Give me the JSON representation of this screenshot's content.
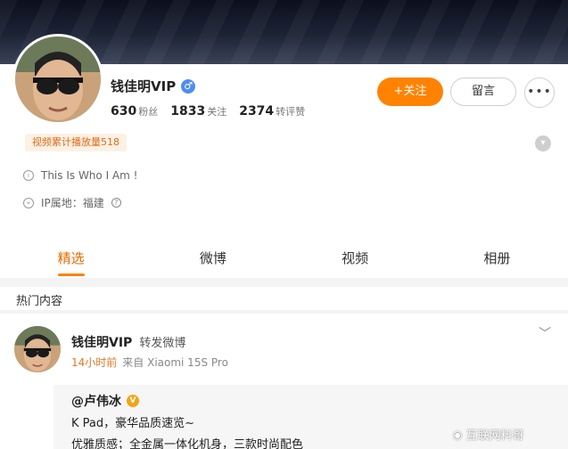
{
  "profile": {
    "username": "钱佳明VIP",
    "stats": [
      {
        "value": "630",
        "label": "粉丝"
      },
      {
        "value": "1833",
        "label": "关注"
      },
      {
        "value": "2374",
        "label": "转评赞"
      }
    ],
    "follow_label": "+关注",
    "message_label": "留言",
    "more_label": "•••",
    "play_badge": "视频累计播放量518",
    "bio": "This Is Who I Am !",
    "ip_location": "IP属地：福建"
  },
  "tabs": [
    "精选",
    "微博",
    "视频",
    "相册"
  ],
  "section_title": "热门内容",
  "post": {
    "author": "钱佳明VIP",
    "action": "转发微博",
    "time": "14小时前",
    "source": "来自 Xiaomi 15S Pro",
    "repost": {
      "author": "@卢伟冰",
      "line1": "K Pad，豪华品质速览~",
      "line2": "优雅质感；全金属一体化机身，三款时尚配色"
    }
  },
  "watermark": "互联网料哥",
  "colors": {
    "accent": "#ff8200",
    "verified": "#4c8ef0",
    "gold_v": "#f3a514"
  },
  "icons": [
    "gender-male-icon",
    "expand-icon",
    "info-icon",
    "location-icon",
    "help-icon",
    "chevron-down-icon",
    "verified-gold-icon",
    "weibo-icon"
  ]
}
